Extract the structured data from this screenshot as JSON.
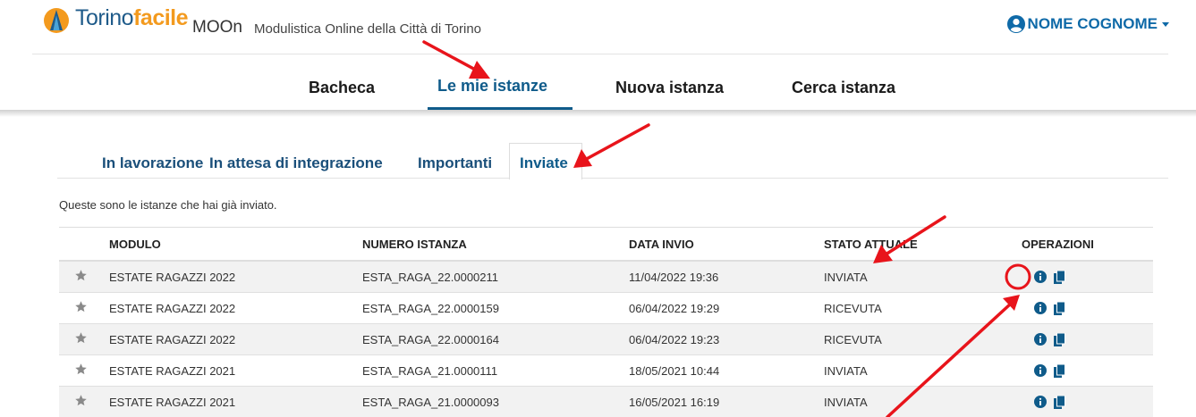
{
  "header": {
    "brand_part1": "Torino",
    "brand_part2": "facile",
    "app_name": "MOOn",
    "app_subtitle": "Modulistica Online della Città di Torino",
    "user_name": "NOME COGNOME"
  },
  "main_nav": {
    "tabs": [
      {
        "label": "Bacheca"
      },
      {
        "label": "Le mie istanze"
      },
      {
        "label": "Nuova istanza"
      },
      {
        "label": "Cerca istanza"
      }
    ],
    "active": "Le mie istanze"
  },
  "sub_tabs": {
    "tabs": [
      {
        "label": "In lavorazione"
      },
      {
        "label": "In attesa di integrazione"
      },
      {
        "label": "Importanti"
      },
      {
        "label": "Inviate"
      }
    ],
    "active": "Inviate"
  },
  "intro_text": "Queste sono le istanze che hai già inviato.",
  "table": {
    "columns": [
      "",
      "MODULO",
      "NUMERO ISTANZA",
      "DATA INVIO",
      "STATO ATTUALE",
      "OPERAZIONI"
    ],
    "rows": [
      {
        "modulo": "ESTATE RAGAZZI 2022",
        "numero": "ESTA_RAGA_22.0000211",
        "data": "11/04/2022 19:36",
        "stato": "INVIATA"
      },
      {
        "modulo": "ESTATE RAGAZZI 2022",
        "numero": "ESTA_RAGA_22.0000159",
        "data": "06/04/2022 19:29",
        "stato": "RICEVUTA"
      },
      {
        "modulo": "ESTATE RAGAZZI 2022",
        "numero": "ESTA_RAGA_22.0000164",
        "data": "06/04/2022 19:23",
        "stato": "RICEVUTA"
      },
      {
        "modulo": "ESTATE RAGAZZI 2021",
        "numero": "ESTA_RAGA_21.0000111",
        "data": "18/05/2021 10:44",
        "stato": "INVIATA"
      },
      {
        "modulo": "ESTATE RAGAZZI 2021",
        "numero": "ESTA_RAGA_21.0000093",
        "data": "16/05/2021 16:19",
        "stato": "INVIATA"
      }
    ]
  },
  "icons": {
    "star": "star-icon",
    "info": "info-icon",
    "copy": "copy-icon",
    "user": "user-circle-icon",
    "caret": "caret-down-icon"
  },
  "colors": {
    "brand_blue": "#1f5b8a",
    "brand_orange": "#f39a1e",
    "accent": "#0f5b8a",
    "annotation_red": "#e8141b"
  }
}
